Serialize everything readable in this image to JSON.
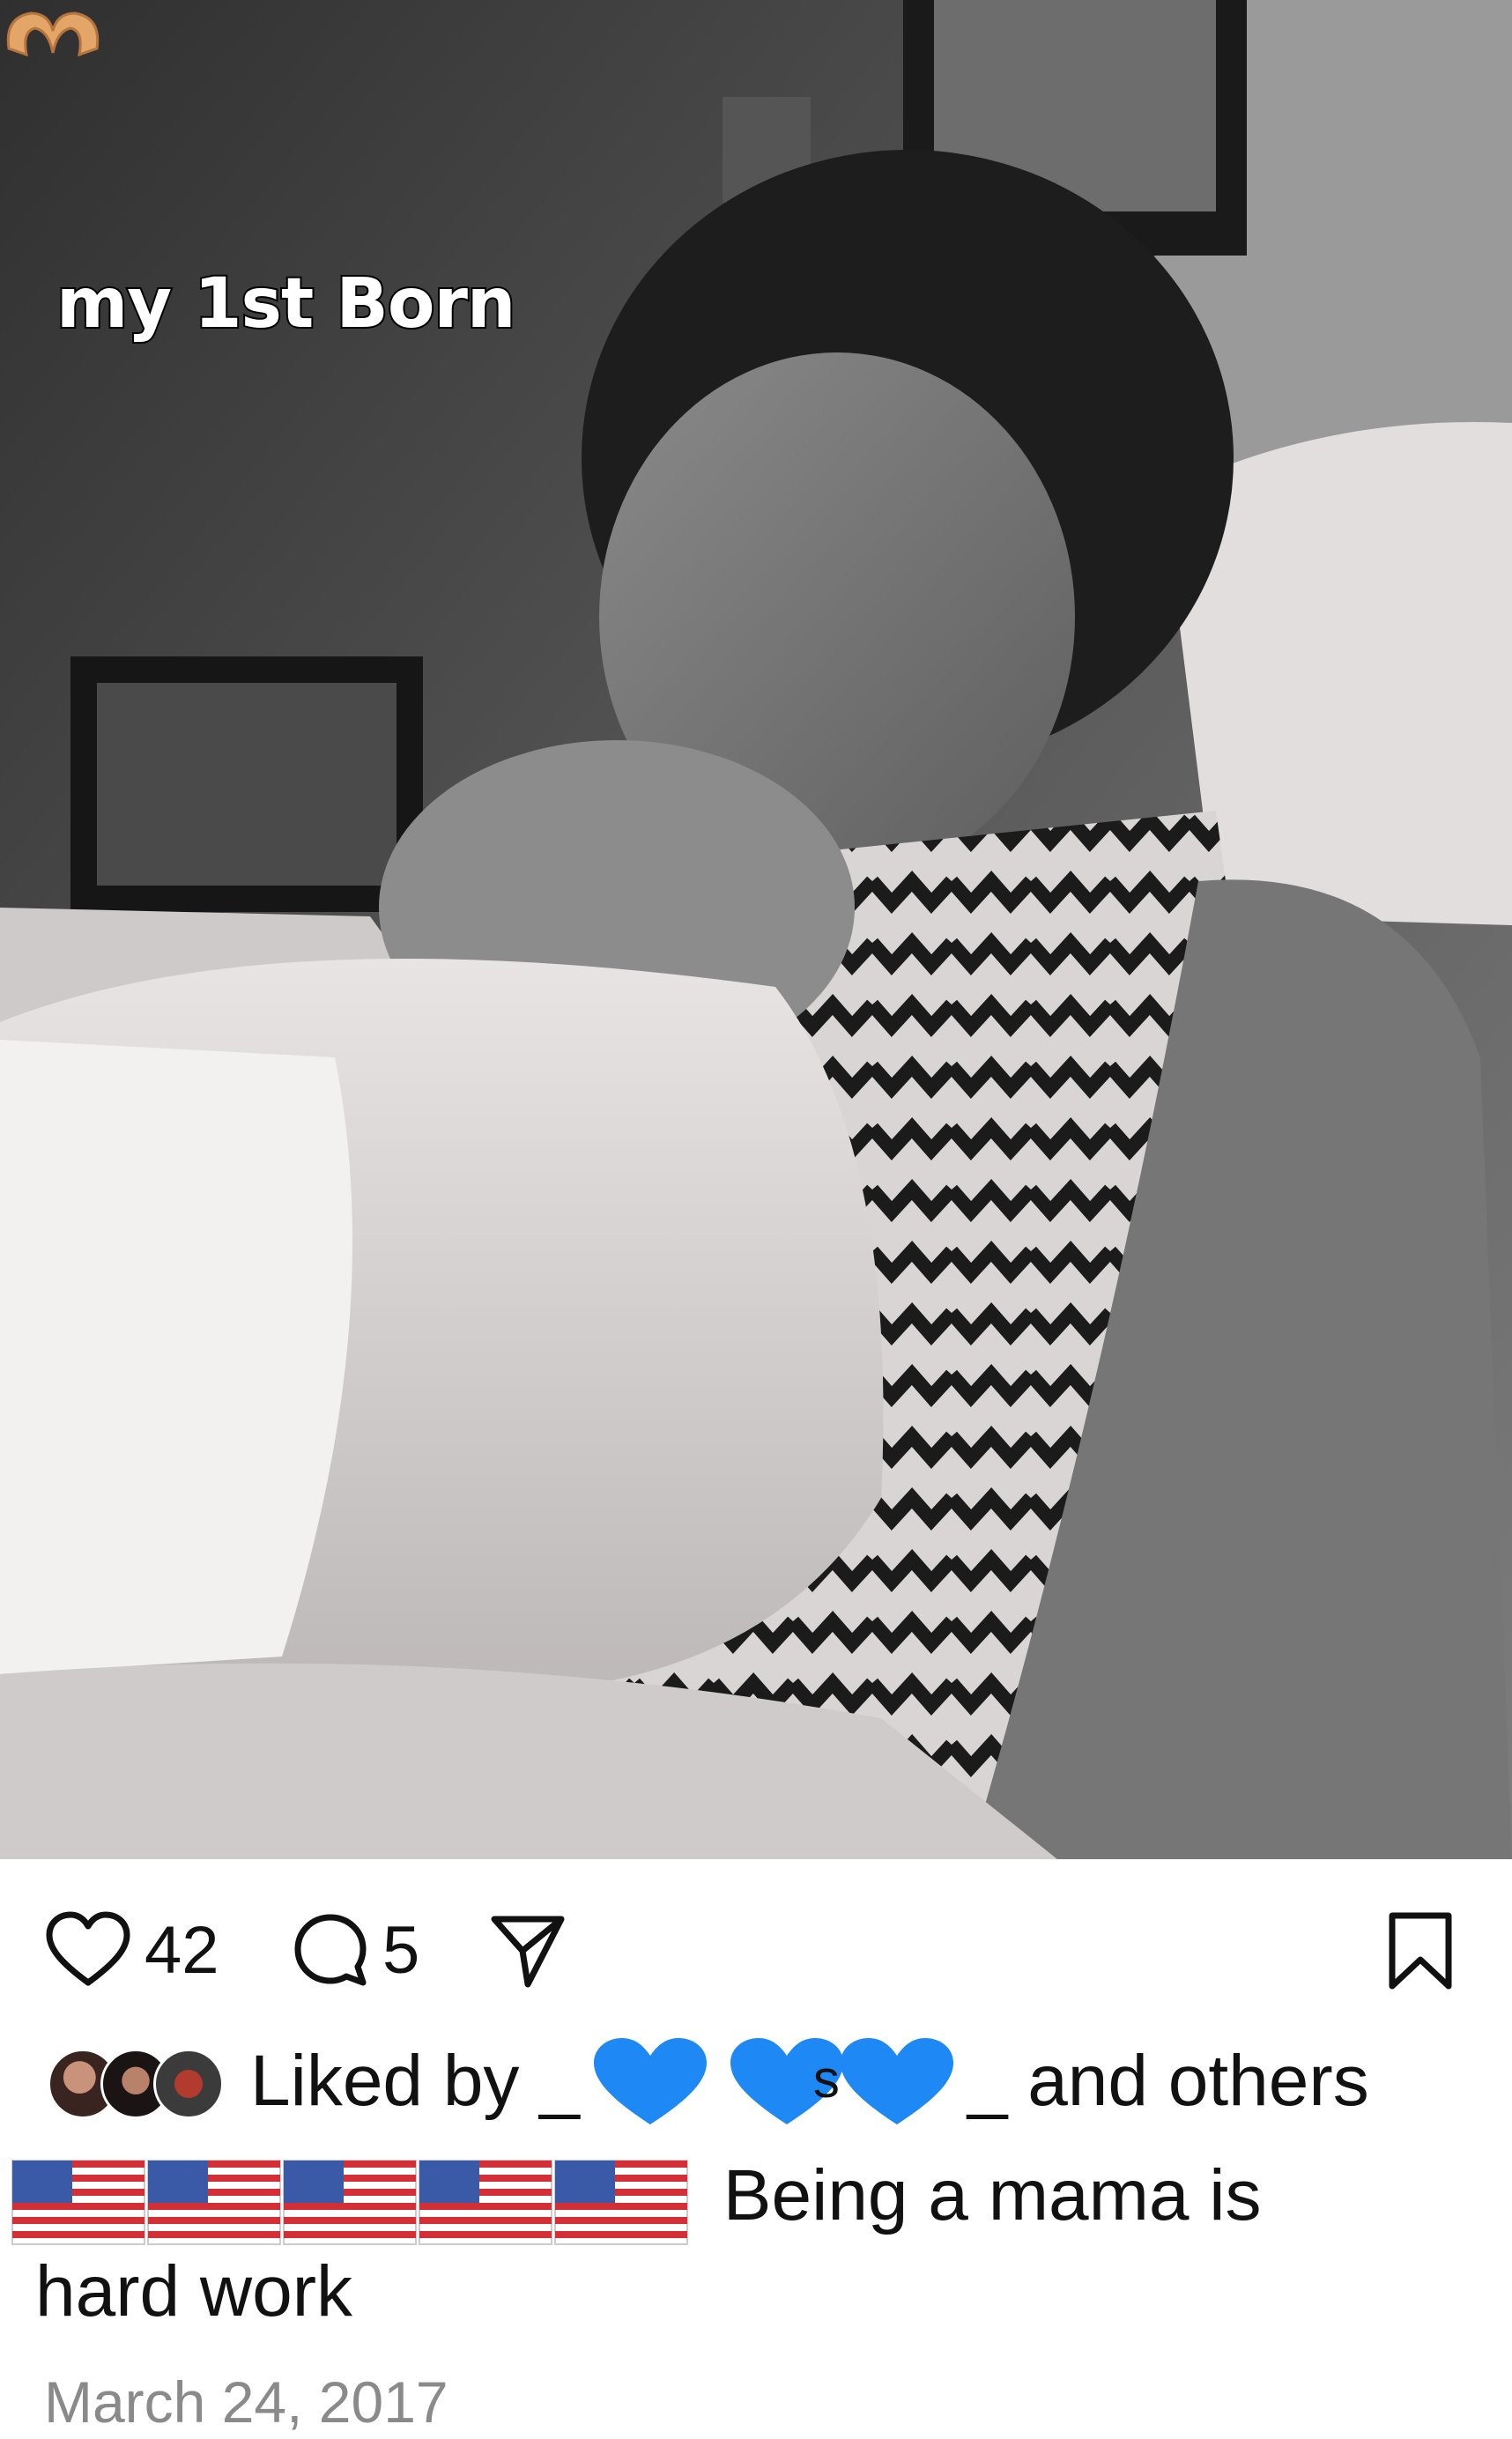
{
  "post": {
    "overlay_text": "my 1st Born",
    "overlay_emoji": "heart-hands-emoji"
  },
  "actions": {
    "like_count": "42",
    "comment_count": "5"
  },
  "likes": {
    "prefix": "Liked by _",
    "middle": "s",
    "suffix": "_ and others"
  },
  "caption": {
    "text_line1": "Being a mama is",
    "text_line2": "hard work"
  },
  "date": "March 24, 2017",
  "colors": {
    "heart_blue": "#1e88f5",
    "muted_text": "#8a8a8a"
  }
}
